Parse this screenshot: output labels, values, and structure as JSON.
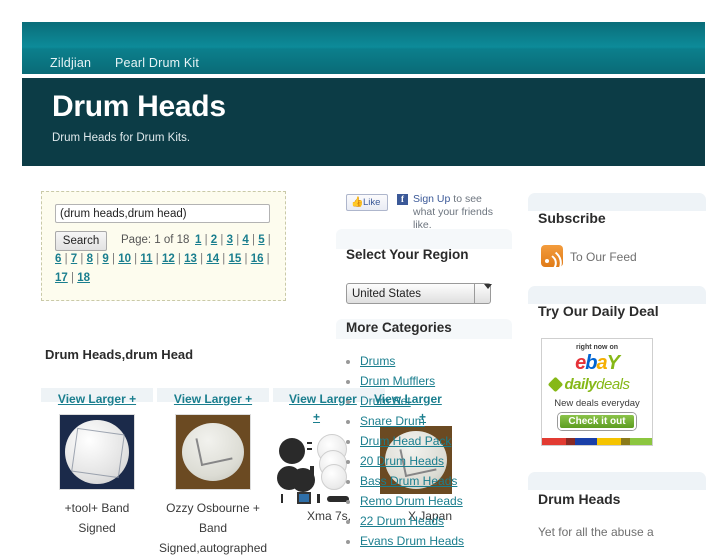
{
  "nav": {
    "links": [
      {
        "label": "Zildjian"
      },
      {
        "label": "Pearl Drum Kit"
      }
    ]
  },
  "header": {
    "title": "Drum Heads",
    "tagline": "Drum Heads for Drum Kits."
  },
  "search": {
    "value": "(drum heads,drum head)",
    "placeholder": "(drum heads,drum head)",
    "button_label": "Search",
    "page_indicator": "Page: 1 of 18",
    "pages": [
      "1",
      "2",
      "3",
      "4",
      "5",
      "6",
      "7",
      "8",
      "9",
      "10",
      "11",
      "12",
      "13",
      "14",
      "15",
      "16",
      "17",
      "18"
    ]
  },
  "results": {
    "heading": "Drum Heads,drum Head",
    "view_larger_label": "View Larger +",
    "view_larger_label_wrapped": "View Larger",
    "plus": "+",
    "items": [
      {
        "view_larger": "View Larger +",
        "caption_lines": [
          "+tool+ Band",
          "Signed"
        ],
        "art": "dh-a"
      },
      {
        "view_larger": "View Larger +",
        "caption_lines": [
          "Ozzy Osbourne +",
          "Band",
          "Signed,autographed"
        ],
        "art": "dh-b"
      },
      {
        "view_larger": "View Larger",
        "caption_lines": [
          "Xma 7s,"
        ],
        "art": "kit"
      },
      {
        "view_larger": "View Larger",
        "caption_lines": [
          "X Japan"
        ],
        "art": "dh-b"
      }
    ]
  },
  "facebook": {
    "like_label": "Like",
    "signup_link": "Sign Up",
    "signup_text": " to see what your friends like."
  },
  "region": {
    "title": "Select Your Region",
    "selected": "United States",
    "options": [
      "United States"
    ]
  },
  "categories": {
    "title": "More Categories",
    "items": [
      {
        "label": "Drums"
      },
      {
        "label": "Drum Mufflers"
      },
      {
        "label": "Drum Set"
      },
      {
        "label": "Snare Drum"
      },
      {
        "label": "Drum Head Pack"
      },
      {
        "label": "20 Drum Heads"
      },
      {
        "label": "Bass Drum Heads"
      },
      {
        "label": "Remo Drum Heads"
      },
      {
        "label": "22 Drum Heads"
      },
      {
        "label": "Evans Drum Heads"
      }
    ]
  },
  "sidebar": {
    "subscribe_title": "Subscribe",
    "rss_label": "To Our Feed",
    "deal_title": "Try Our Daily Deal",
    "deal_banner": {
      "right_now_on": "right now on",
      "brand_e": "e",
      "brand_b": "b",
      "brand_a": "a",
      "brand_y": "Y",
      "daily": "daily",
      "deals": "deals",
      "new_deals": "New deals everyday",
      "cta": "Check it out"
    },
    "article_title": "Drum Heads",
    "article_text": "Yet for all the abuse a"
  },
  "colors": {
    "nav_teal": "#0d8b99",
    "title_band": "#0c3c46",
    "link_teal": "#1a7e8e",
    "search_panel_bg": "#fdfcee",
    "panel_bg": "#eef3f7",
    "rss_orange": "#e07b17"
  }
}
